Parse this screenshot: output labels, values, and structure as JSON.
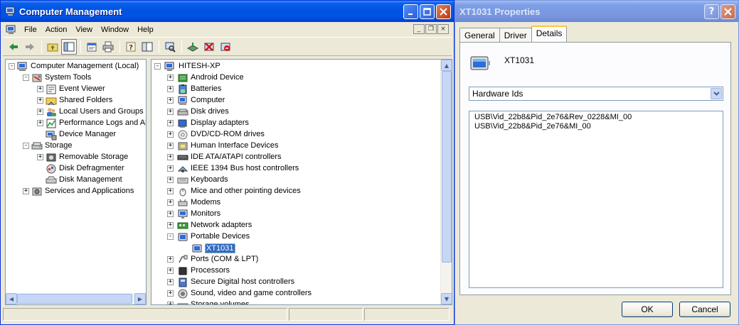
{
  "computer_management": {
    "title": "Computer Management",
    "menu": [
      "File",
      "Action",
      "View",
      "Window",
      "Help"
    ],
    "mdi_controls": [
      "_",
      "❐",
      "×"
    ],
    "left_tree": [
      {
        "label": "Computer Management (Local)",
        "level": 0,
        "expander": "-",
        "icon": "computer-management-icon"
      },
      {
        "label": "System Tools",
        "level": 1,
        "expander": "-",
        "icon": "system-tools-icon"
      },
      {
        "label": "Event Viewer",
        "level": 2,
        "expander": "+",
        "icon": "event-viewer-icon"
      },
      {
        "label": "Shared Folders",
        "level": 2,
        "expander": "+",
        "icon": "shared-folders-icon"
      },
      {
        "label": "Local Users and Groups",
        "level": 2,
        "expander": "+",
        "icon": "users-icon"
      },
      {
        "label": "Performance Logs and Alerts",
        "level": 2,
        "expander": "+",
        "icon": "performance-icon"
      },
      {
        "label": "Device Manager",
        "level": 2,
        "expander": "",
        "icon": "device-manager-icon"
      },
      {
        "label": "Storage",
        "level": 1,
        "expander": "-",
        "icon": "storage-icon"
      },
      {
        "label": "Removable Storage",
        "level": 2,
        "expander": "+",
        "icon": "removable-storage-icon"
      },
      {
        "label": "Disk Defragmenter",
        "level": 2,
        "expander": "",
        "icon": "defrag-icon"
      },
      {
        "label": "Disk Management",
        "level": 2,
        "expander": "",
        "icon": "disk-management-icon"
      },
      {
        "label": "Services and Applications",
        "level": 1,
        "expander": "+",
        "icon": "services-icon"
      }
    ],
    "device_tree": {
      "root": "HITESH-XP",
      "items": [
        {
          "label": "Android Device",
          "expander": "+",
          "icon": "android-device-icon"
        },
        {
          "label": "Batteries",
          "expander": "+",
          "icon": "battery-icon"
        },
        {
          "label": "Computer",
          "expander": "+",
          "icon": "computer-icon"
        },
        {
          "label": "Disk drives",
          "expander": "+",
          "icon": "disk-drive-icon"
        },
        {
          "label": "Display adapters",
          "expander": "+",
          "icon": "display-adapter-icon"
        },
        {
          "label": "DVD/CD-ROM drives",
          "expander": "+",
          "icon": "dvd-drive-icon"
        },
        {
          "label": "Human Interface Devices",
          "expander": "+",
          "icon": "hid-icon"
        },
        {
          "label": "IDE ATA/ATAPI controllers",
          "expander": "+",
          "icon": "ide-controller-icon"
        },
        {
          "label": "IEEE 1394 Bus host controllers",
          "expander": "+",
          "icon": "ieee1394-icon"
        },
        {
          "label": "Keyboards",
          "expander": "+",
          "icon": "keyboard-icon"
        },
        {
          "label": "Mice and other pointing devices",
          "expander": "+",
          "icon": "mouse-icon"
        },
        {
          "label": "Modems",
          "expander": "+",
          "icon": "modem-icon"
        },
        {
          "label": "Monitors",
          "expander": "+",
          "icon": "monitor-icon"
        },
        {
          "label": "Network adapters",
          "expander": "+",
          "icon": "network-adapter-icon"
        },
        {
          "label": "Portable Devices",
          "expander": "-",
          "icon": "portable-devices-icon"
        },
        {
          "label": "XT1031",
          "expander": "",
          "icon": "phone-device-icon",
          "child": true,
          "selected": true
        },
        {
          "label": "Ports (COM & LPT)",
          "expander": "+",
          "icon": "ports-icon"
        },
        {
          "label": "Processors",
          "expander": "+",
          "icon": "processor-icon"
        },
        {
          "label": "Secure Digital host controllers",
          "expander": "+",
          "icon": "sd-controller-icon"
        },
        {
          "label": "Sound, video and game controllers",
          "expander": "+",
          "icon": "sound-icon"
        },
        {
          "label": "Storage volumes",
          "expander": "+",
          "icon": "storage-volume-icon"
        }
      ]
    }
  },
  "properties": {
    "title": "XT1031 Properties",
    "title_buttons": [
      "?",
      "×"
    ],
    "tabs": [
      "General",
      "Driver",
      "Details"
    ],
    "active_tab": "Details",
    "device_name": "XT1031",
    "property_select": "Hardware Ids",
    "values": [
      "USB\\Vid_22b8&Pid_2e76&Rev_0228&MI_00",
      "USB\\Vid_22b8&Pid_2e76&MI_00"
    ],
    "ok_label": "OK",
    "cancel_label": "Cancel"
  },
  "colors": {
    "selection": "#316ac5",
    "xp_title_active": "#0054e3",
    "xp_title_inactive": "#7a96df",
    "window_face": "#ece9d8"
  }
}
